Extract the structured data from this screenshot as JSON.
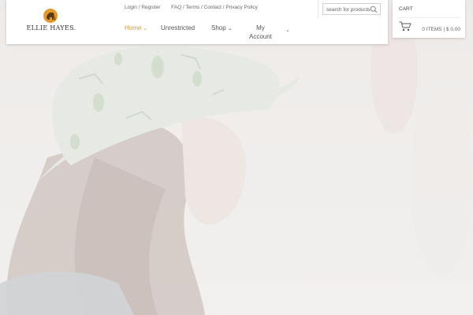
{
  "brand": {
    "name": "ELLIE HAYES.",
    "logo_icon": "elephant-icon",
    "accent": "#e39a2d"
  },
  "top_links": {
    "login": "Login / Register",
    "info": "FAQ / Terms / Contact / Privacy Policy"
  },
  "search": {
    "placeholder": "search for products",
    "icon": "search-icon"
  },
  "nav": {
    "home": "Home",
    "unrestricted": "Unrestricted",
    "shop": "Shop",
    "account_line1": "My",
    "account_line2": "Account",
    "active_color": "#d39a3a"
  },
  "cart": {
    "title": "CART",
    "summary": "0 ITEMS | $ 0.00",
    "icon": "cart-icon"
  },
  "hero": {
    "description_icon": "hero-image"
  }
}
